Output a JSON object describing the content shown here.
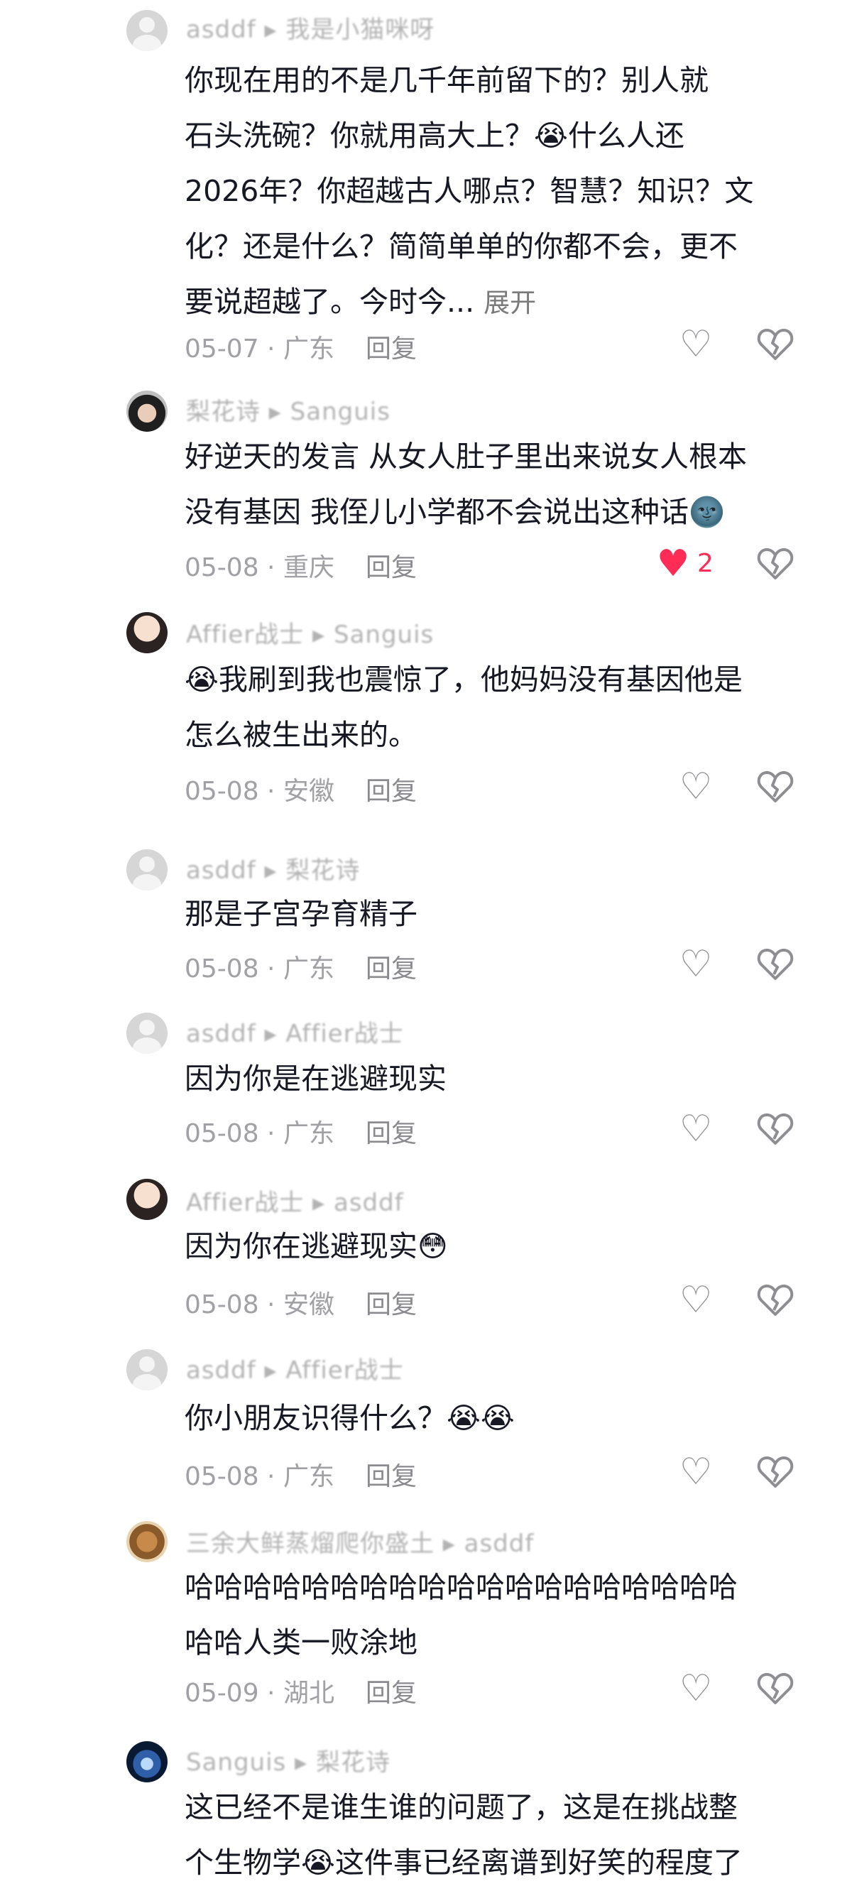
{
  "comments": [
    {
      "user": "asddf ▸ 我是小猫咪呀",
      "avatar": "default-avatar",
      "emoji_lead": "😭",
      "text": "你现在用的不是几千年前留下的？别人就\n石头洗碗？你就用高大上？😭什么人还\n2026年？你超越古人哪点？智慧？知识？文\n化？还是什么？简简单单的你都不会，更不\n要说超越了。今时今...",
      "expand": "展开",
      "date": "05-07",
      "region": "广东",
      "reply": "回复"
    },
    {
      "user": "梨花诗 ▸ Sanguis",
      "avatar": "photo-avatar",
      "text": "好逆天的发言 从女人肚子里出来说女人根本\n没有基因 我侄儿小学都不会说出这种话🌚",
      "date": "05-08",
      "region": "重庆",
      "reply": "回复",
      "likes": "2"
    },
    {
      "user": "Affier战士 ▸ Sanguis",
      "avatar": "photo-avatar",
      "text": "😭我刷到我也震惊了，他妈妈没有基因他是\n怎么被生出来的。",
      "date": "05-08",
      "region": "安徽",
      "reply": "回复"
    },
    {
      "user": "asddf ▸ 梨花诗",
      "avatar": "default-avatar",
      "text": "那是子宫孕育精子",
      "date": "05-08",
      "region": "广东",
      "reply": "回复"
    },
    {
      "user": "asddf ▸ Affier战士",
      "avatar": "default-avatar",
      "text": "因为你是在逃避现实",
      "date": "05-08",
      "region": "广东",
      "reply": "回复"
    },
    {
      "user": "Affier战士 ▸ asddf",
      "avatar": "photo-avatar",
      "text": "因为你在逃避现实😳",
      "date": "05-08",
      "region": "安徽",
      "reply": "回复"
    },
    {
      "user": "asddf ▸ Affier战士",
      "avatar": "default-avatar",
      "text": "你小朋友识得什么？😭😭",
      "date": "05-08",
      "region": "广东",
      "reply": "回复"
    },
    {
      "user": "三余大鲜蒸熘爬你盛土 ▸ asddf",
      "avatar": "photo-avatar",
      "text": "哈哈哈哈哈哈哈哈哈哈哈哈哈哈哈哈哈哈哈\n哈哈人类一败涂地",
      "date": "05-09",
      "region": "湖北",
      "reply": "回复"
    },
    {
      "user": "Sanguis ▸ 梨花诗",
      "avatar": "photo-avatar",
      "text": "这已经不是谁生谁的问题了，这是在挑战整\n个生物学😭这件事已经离谱到好笑的程度了"
    }
  ],
  "icons": {
    "like": "heart-outline-icon",
    "liked": "heart-filled-icon",
    "dislike": "broken-heart-icon"
  },
  "colors": {
    "text": "#161823",
    "meta": "#a0a0a5",
    "liked": "#ff2c55"
  }
}
